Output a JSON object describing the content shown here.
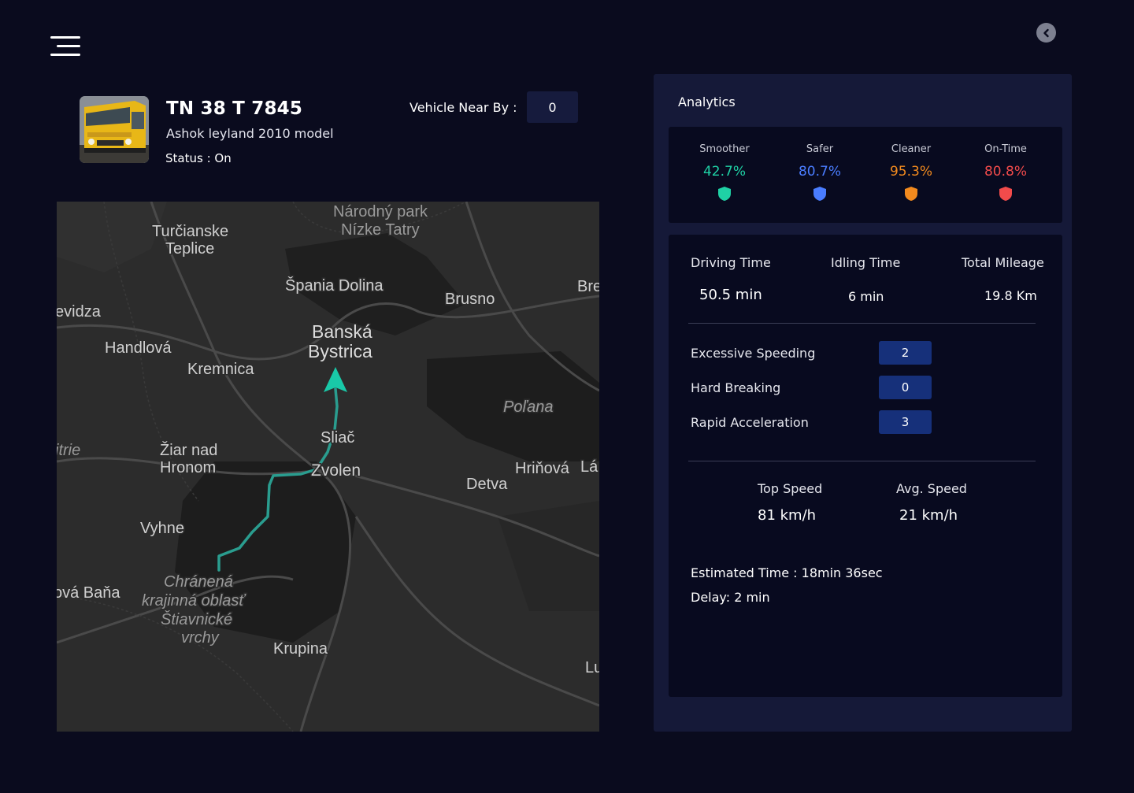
{
  "header": {
    "menu_icon": "hamburger-menu-icon",
    "back_icon": "chevron-left-icon"
  },
  "vehicle": {
    "plate": "TN 38 T 7845",
    "model": "Ashok leyland 2010 model",
    "status": "Status : On",
    "near_by_label": "Vehicle Near By :",
    "near_by_value": "0"
  },
  "map": {
    "labels": {
      "narodny": "Národný park",
      "nizke": "Nízke Tatry",
      "turcianske": "Turčianske",
      "teplice": "Teplice",
      "spania": "Špania Dolina",
      "brusno": "Brusno",
      "bre": "Bre",
      "evidza": "evidza",
      "handlova": "Handlová",
      "banska": "Banská",
      "bystrica": "Bystrica",
      "kremnica": "Kremnica",
      "polana": "Poľana",
      "sliac": "Sliač",
      "itrie": "itrie",
      "ziar": "Žiar nad",
      "hronom": "Hronom",
      "zvolen": "Zvolen",
      "hrinova": "Hriňová",
      "la": "Lá",
      "detva": "Detva",
      "vyhne": "Vyhne",
      "chranena": "Chránená",
      "krajinna": "krajinná oblasť",
      "stiavnicke": "Štiavnické",
      "vrchy": "vrchy",
      "vabana": "ová Baňa",
      "krupina": "Krupina",
      "lu": "Lu"
    },
    "route_color": "#2a9d8f",
    "marker_color": "#19c9a8"
  },
  "analytics": {
    "title": "Analytics",
    "scores": [
      {
        "label": "Smoother",
        "value": "42.7%",
        "color": "#1fd1a5"
      },
      {
        "label": "Safer",
        "value": "80.7%",
        "color": "#4a7dff"
      },
      {
        "label": "Cleaner",
        "value": "95.3%",
        "color": "#f28a1e"
      },
      {
        "label": "On-Time",
        "value": "80.8%",
        "color": "#f24b4b"
      }
    ],
    "driving_time_label": "Driving Time",
    "driving_time_value": "50.5 min",
    "idling_time_label": "Idling Time",
    "idling_time_value": "6 min",
    "total_mileage_label": "Total Mileage",
    "total_mileage_value": "19.8 Km",
    "events": [
      {
        "label": "Excessive Speeding",
        "value": "2"
      },
      {
        "label": "Hard Breaking",
        "value": "0"
      },
      {
        "label": "Rapid Acceleration",
        "value": "3"
      }
    ],
    "top_speed_label": "Top Speed",
    "top_speed_value": "81 km/h",
    "avg_speed_label": "Avg. Speed",
    "avg_speed_value": "21 km/h",
    "estimated_time": "Estimated Time : 18min 36sec",
    "delay": "Delay:  2 min"
  }
}
